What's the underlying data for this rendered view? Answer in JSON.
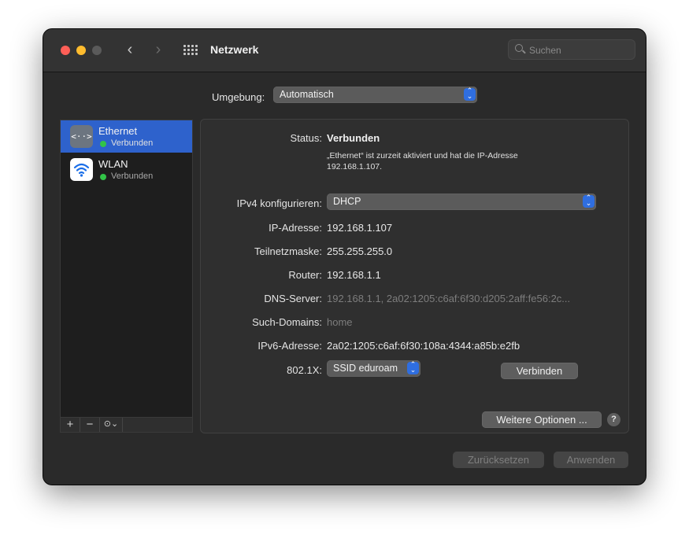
{
  "window": {
    "title": "Netzwerk"
  },
  "search": {
    "placeholder": "Suchen"
  },
  "umgebung": {
    "label": "Umgebung:",
    "value": "Automatisch"
  },
  "services": [
    {
      "name": "Ethernet",
      "status": "Verbunden",
      "selected": true,
      "icon": "ethernet-icon",
      "status_color": "#32c448"
    },
    {
      "name": "WLAN",
      "status": "Verbunden",
      "selected": false,
      "icon": "wifi-icon",
      "status_color": "#32c448"
    }
  ],
  "sidebar_toolbar": {
    "add": "+",
    "remove": "−",
    "actions": "⊙⌄"
  },
  "detail": {
    "status_label": "Status:",
    "status_value": "Verbunden",
    "status_description": "„Ethernet“ ist zurzeit aktiviert und hat die IP-Adresse 192.168.1.107.",
    "ipv4_label": "IPv4 konfigurieren:",
    "ipv4_value": "DHCP",
    "ip_label": "IP-Adresse:",
    "ip_value": "192.168.1.107",
    "subnet_label": "Teilnetzmaske:",
    "subnet_value": "255.255.255.0",
    "router_label": "Router:",
    "router_value": "192.168.1.1",
    "dns_label": "DNS-Server:",
    "dns_value": "192.168.1.1, 2a02:1205:c6af:6f30:d205:2aff:fe56:2c...",
    "domains_label": "Such-Domains:",
    "domains_value": "home",
    "ipv6_label": "IPv6-Adresse:",
    "ipv6_value": "2a02:1205:c6af:6f30:108a:4344:a85b:e2fb",
    "dot1x_label": "802.1X:",
    "dot1x_value": "SSID eduroam",
    "connect_button": "Verbinden",
    "more_options_button": "Weitere Optionen ...",
    "help": "?"
  },
  "footer": {
    "reset_button": "Zurücksetzen",
    "apply_button": "Anwenden"
  },
  "colors": {
    "accent": "#2e62cc",
    "connected": "#32c448"
  }
}
